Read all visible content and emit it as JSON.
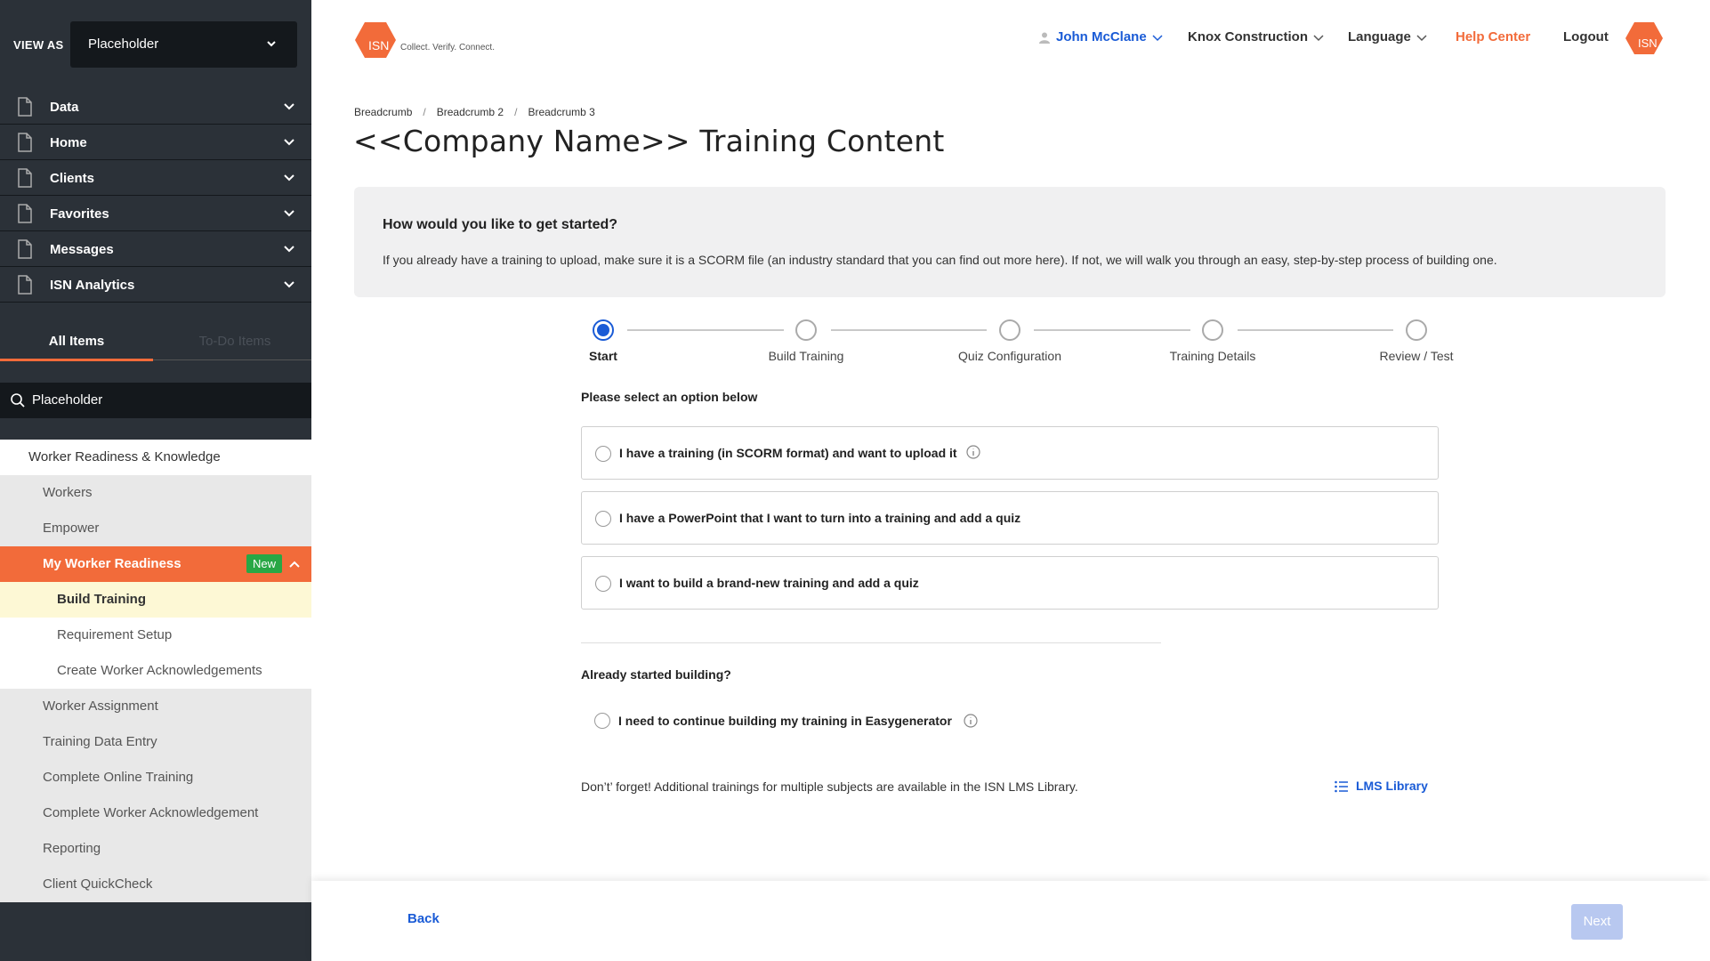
{
  "sidebar": {
    "view_as_label": "VIEW AS",
    "view_as_value": "Placeholder",
    "nav_items": [
      {
        "label": "Data"
      },
      {
        "label": "Home"
      },
      {
        "label": "Clients"
      },
      {
        "label": "Favorites"
      },
      {
        "label": "Messages"
      },
      {
        "label": "ISN Analytics"
      }
    ],
    "tabs": {
      "all": "All Items",
      "todo": "To-Do Items"
    },
    "search_placeholder": "Placeholder",
    "section_title": "Worker Readiness & Knowledge",
    "sub_items": {
      "workers": "Workers",
      "empower": "Empower",
      "my_worker_readiness": "My Worker Readiness",
      "badge_new": "New",
      "build_training": "Build Training",
      "requirement_setup": "Requirement Setup",
      "create_ack": "Create Worker Acknowledgements",
      "worker_assignment": "Worker Assignment",
      "training_data_entry": "Training Data Entry",
      "complete_online_training": "Complete Online Training",
      "complete_worker_ack": "Complete Worker Acknowledgement",
      "reporting": "Reporting",
      "client_quickcheck": "Client QuickCheck"
    }
  },
  "header": {
    "logo_text": "ISN",
    "tagline": "Collect. Verify. Connect.",
    "user": "John McClane",
    "company": "Knox Construction",
    "language": "Language",
    "help": "Help Center",
    "logout": "Logout",
    "avatar_text": "ISN"
  },
  "main": {
    "breadcrumbs": [
      "Breadcrumb",
      "Breadcrumb 2",
      "Breadcrumb 3"
    ],
    "title": "<<Company Name>> Training Content",
    "intro_heading": "How would you like to get started?",
    "intro_text": "If you already have a training to upload, make sure it is a SCORM file (an industry standard that you can find out more here). If not, we will walk you through an easy, step-by-step process of building one.",
    "steps": [
      "Start",
      "Build Training",
      "Quiz Configuration",
      "Training Details",
      "Review / Test"
    ],
    "active_step": 0,
    "prompt": "Please select an option below",
    "options": [
      "I have a training (in SCORM format) and want to upload it",
      "I have a PowerPoint that I want to turn into a training and add a quiz",
      "I want to build a brand-new training and add a quiz"
    ],
    "already_heading": "Already started building?",
    "continue_option": "I need to continue building my training in Easygenerator",
    "reminder": "Don’t’ forget! Additional trainings for multiple subjects are available in the ISN LMS Library.",
    "lms_link": "LMS Library"
  },
  "footer": {
    "back": "Back",
    "next": "Next"
  },
  "colors": {
    "accent": "#f26b3a",
    "link": "#1a5bd6",
    "sidebar_bg": "#2b3138",
    "badge_green": "#28a745"
  }
}
